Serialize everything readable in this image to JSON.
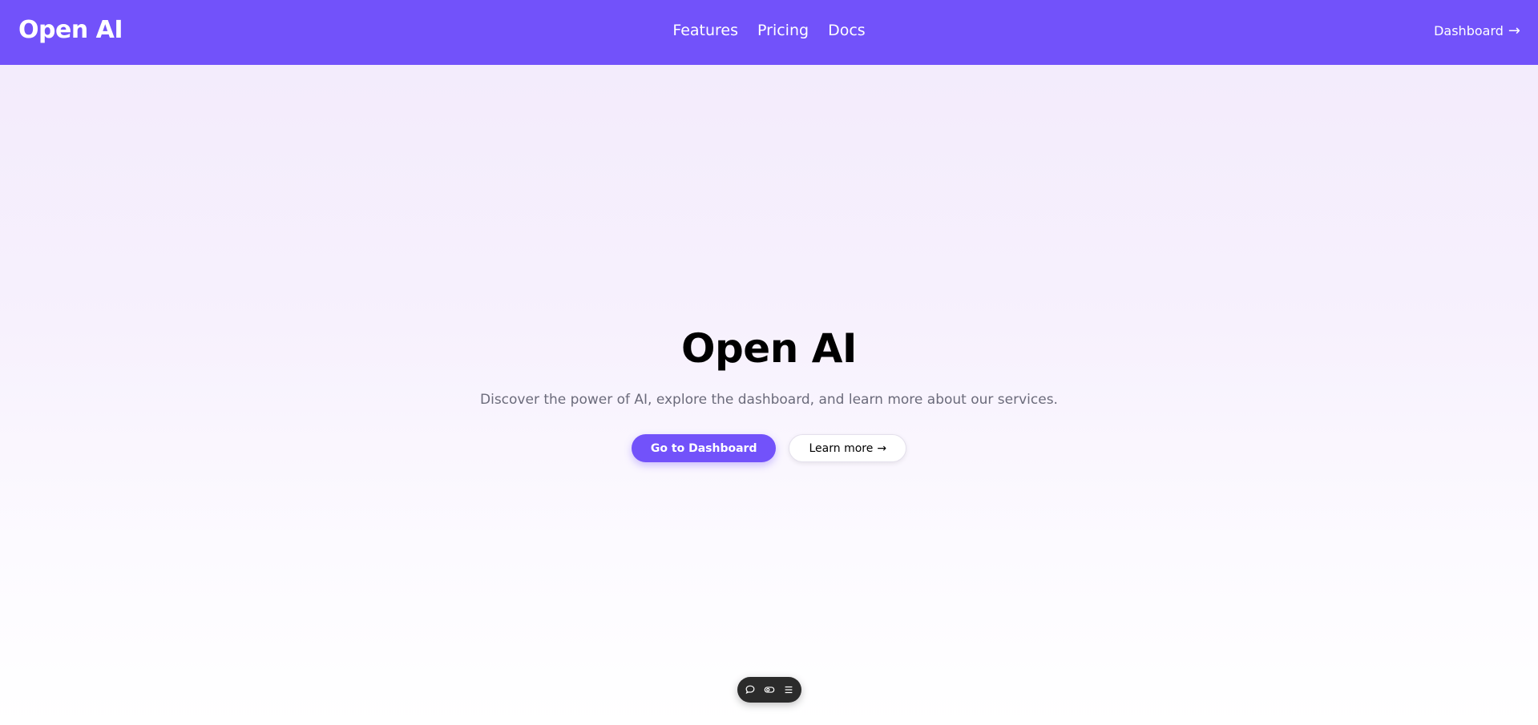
{
  "header": {
    "brand": "Open AI",
    "nav": [
      {
        "label": "Features"
      },
      {
        "label": "Pricing"
      },
      {
        "label": "Docs"
      }
    ],
    "dashboard_link": "Dashboard",
    "dashboard_arrow": "→"
  },
  "hero": {
    "title": "Open AI",
    "subtitle": "Discover the power of AI, explore the dashboard, and learn more about our services.",
    "primary_button": "Go to Dashboard",
    "secondary_button": "Learn more",
    "secondary_arrow": "→"
  },
  "toolbar": {
    "icons": [
      "chat-bubble-icon",
      "toggle-icon",
      "menu-icon"
    ]
  },
  "colors": {
    "brand": "#7252fa",
    "toolbar_bg": "#2b2b2b",
    "subtitle": "#6b6b7b"
  }
}
